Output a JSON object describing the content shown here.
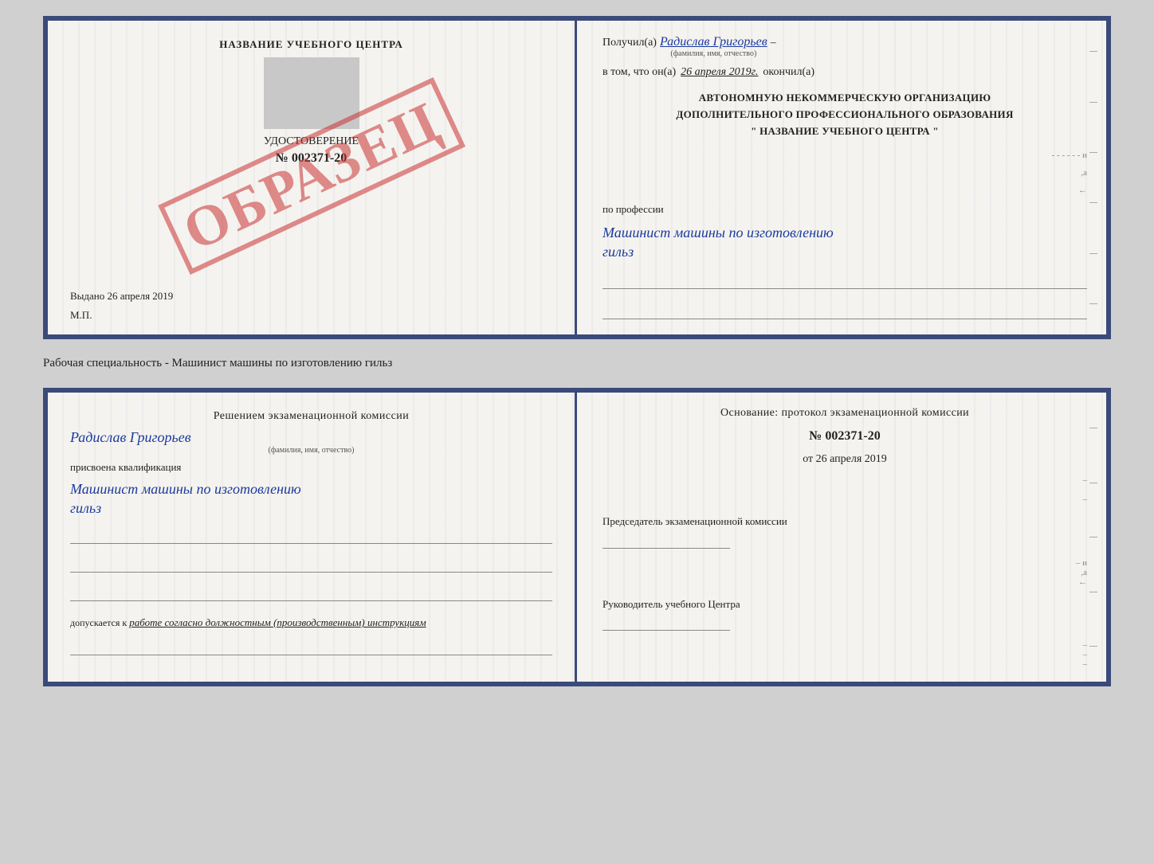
{
  "doc1": {
    "left": {
      "center_title": "НАЗВАНИЕ УЧЕБНОГО ЦЕНТРА",
      "cert_title": "УДОСТОВЕРЕНИЕ",
      "cert_number": "№ 002371-20",
      "issued_label": "Выдано",
      "issued_date": "26 апреля 2019",
      "mp": "М.П.",
      "obrazets": "ОБРАЗЕЦ"
    },
    "right": {
      "received_label": "Получил(а)",
      "received_name": "Радислав Григорьев",
      "received_sublabel": "(фамилия, имя, отчество)",
      "date_prefix": "в том, что он(а)",
      "date_value": "26 апреля 2019г.",
      "date_suffix": "окончил(а)",
      "org_line1": "АВТОНОМНУЮ НЕКОММЕРЧЕСКУЮ ОРГАНИЗАЦИЮ",
      "org_line2": "ДОПОЛНИТЕЛЬНОГО ПРОФЕССИОНАЛЬНОГО ОБРАЗОВАНИЯ",
      "org_line3": "\" НАЗВАНИЕ УЧЕБНОГО ЦЕНТРА \"",
      "profession_label": "по профессии",
      "profession_value": "Машинист машины по изготовлению",
      "profession_value2": "гильз"
    }
  },
  "label": "Рабочая специальность - Машинист машины по изготовлению гильз",
  "doc2": {
    "left": {
      "decision_title": "Решением  экзаменационной  комиссии",
      "person_name": "Радислав Григорьев",
      "person_sublabel": "(фамилия, имя, отчество)",
      "qualification_prefix": "присвоена квалификация",
      "qualification_value": "Машинист машины по изготовлению",
      "qualification_value2": "гильз",
      "допускается_prefix": "допускается к",
      "допускается_value": "работе согласно должностным (производственным) инструкциям"
    },
    "right": {
      "basis_title": "Основание: протокол экзаменационной  комиссии",
      "protocol_number": "№  002371-20",
      "protocol_date_prefix": "от",
      "protocol_date": "26 апреля 2019",
      "chairman_label": "Председатель экзаменационной комиссии",
      "director_label": "Руководитель учебного Центра"
    }
  }
}
